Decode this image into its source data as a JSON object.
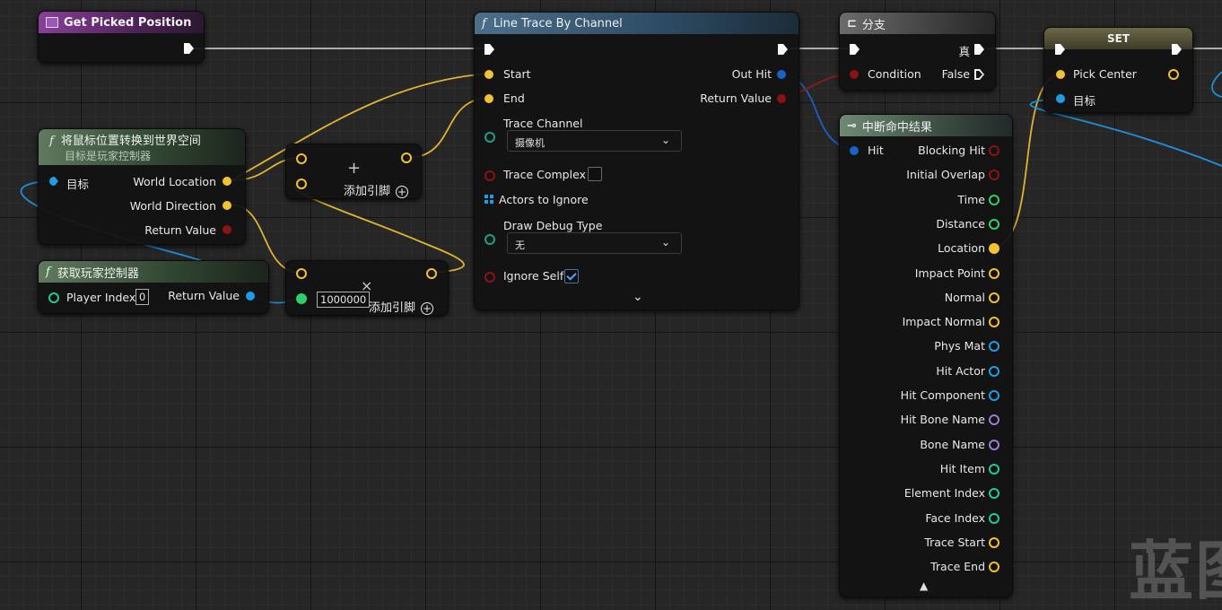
{
  "colors": {
    "exec": "#fafafa",
    "vector": "#f1c232",
    "object": "#1f9de3",
    "bool": "#8b1313",
    "struct": "#1a62c8",
    "float": "#2ed06a",
    "name": "#a07bd6",
    "int": "#20c997",
    "wire_exec": "#dcdcdc",
    "wire_vector": "#e7b933",
    "wire_object": "#1e90d8",
    "wire_bool": "#8b1a1a"
  },
  "nodes": {
    "get_picked": {
      "title": "Get Picked Position"
    },
    "convert": {
      "title": "将鼠标位置转换到世界空间",
      "subtitle": "目标是玩家控制器",
      "fn_icon": "f",
      "in_target": "目标",
      "out_world_location": "World Location",
      "out_world_direction": "World Direction",
      "out_return": "Return Value"
    },
    "get_controller": {
      "title": "获取玩家控制器",
      "fn_icon": "f",
      "in_player_index": "Player Index",
      "player_index_value": "0",
      "out_return": "Return Value"
    },
    "add": {
      "symbol": "+",
      "add_pin": "添加引脚"
    },
    "multiply": {
      "symbol": "×",
      "value": "1000000",
      "add_pin": "添加引脚"
    },
    "line_trace": {
      "title": "Line Trace By Channel",
      "fn_icon": "f",
      "in_start": "Start",
      "in_end": "End",
      "trace_channel_label": "Trace Channel",
      "trace_channel_value": "摄像机",
      "trace_complex": "Trace Complex",
      "actors_to_ignore": "Actors to Ignore",
      "draw_debug_label": "Draw Debug Type",
      "draw_debug_value": "无",
      "ignore_self": "Ignore Self",
      "out_hit": "Out Hit",
      "out_return": "Return Value"
    },
    "branch": {
      "title": "分支",
      "in_condition": "Condition",
      "out_true": "真",
      "out_false": "False"
    },
    "break_hit": {
      "title": "中断命中结果",
      "in_hit": "Hit",
      "outputs": [
        "Blocking Hit",
        "Initial Overlap",
        "Time",
        "Distance",
        "Location",
        "Impact Point",
        "Normal",
        "Impact Normal",
        "Phys Mat",
        "Hit Actor",
        "Hit Component",
        "Hit Bone Name",
        "Bone Name",
        "Hit Item",
        "Element Index",
        "Face Index",
        "Trace Start",
        "Trace End"
      ]
    },
    "set": {
      "title": "SET",
      "in_pick_center": "Pick Center",
      "in_target": "目标"
    }
  },
  "watermark": "蓝图"
}
